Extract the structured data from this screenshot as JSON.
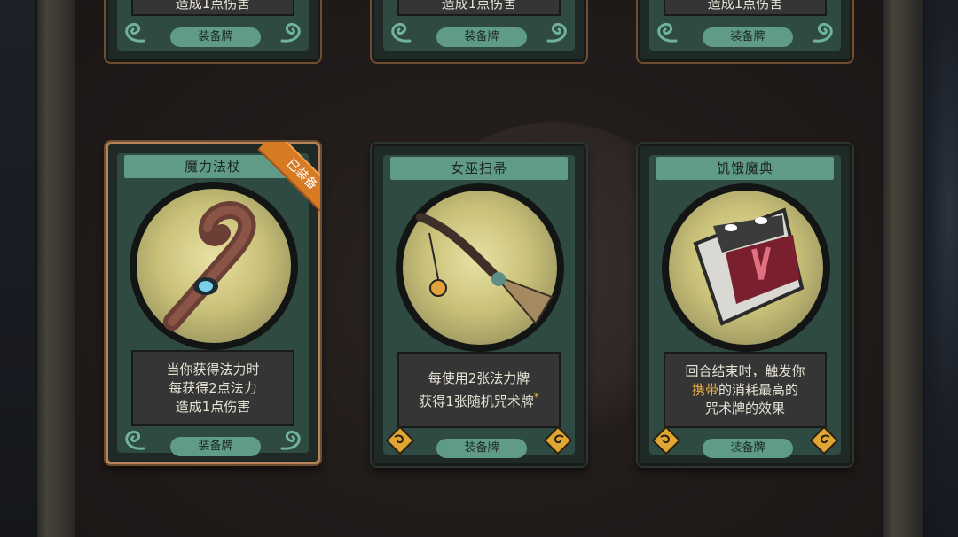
{
  "cards_top": [
    {
      "desc": "造成1点伤害",
      "button": "装备牌"
    },
    {
      "desc": "造成1点伤害",
      "button": "装备牌"
    },
    {
      "desc": "造成1点伤害",
      "button": "装备牌"
    }
  ],
  "cards": [
    {
      "title": "魔力法杖",
      "badge": "已装备",
      "equipped": true,
      "desc": [
        "当你获得法力时",
        "每获得2点法力",
        "造成1点伤害"
      ],
      "button": "装备牌",
      "art_icon": "magic-staff-icon"
    },
    {
      "title": "女巫扫帚",
      "equipped": false,
      "desc": [
        "每使用2张法力牌",
        "获得1张随机咒术牌"
      ],
      "desc_marker": "*",
      "button": "装备牌",
      "art_icon": "witch-broom-icon"
    },
    {
      "title": "饥饿魔典",
      "equipped": false,
      "desc_prefix_line": "回合结束时，触发你",
      "desc_highlight": "携带",
      "desc_rest": "的消耗最高的",
      "desc_last": "咒术牌的效果",
      "button": "装备牌",
      "art_icon": "hungry-grimoire-icon"
    }
  ],
  "colors": {
    "card_green": "#5f9b86",
    "badge_orange": "#d77a24",
    "highlight": "#e9b14a"
  }
}
